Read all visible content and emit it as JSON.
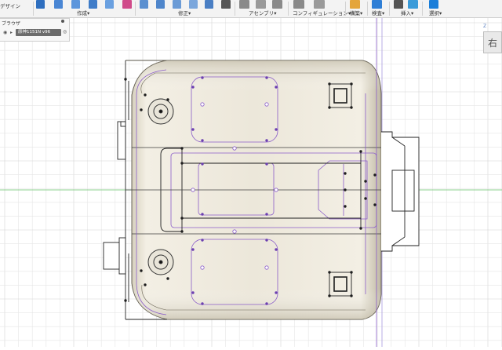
{
  "toolbar": {
    "sections": [
      {
        "label": "作成",
        "color": "#3a78c9"
      },
      {
        "label": "修正",
        "color": "#5a8fd0"
      },
      {
        "label": "アセンブリ",
        "color": "#7b7b7b"
      },
      {
        "label": "コンフィギュレーション",
        "color": "#7b7b7b"
      },
      {
        "label": "構築",
        "color": "#e4a53b"
      },
      {
        "label": "検査",
        "color": "#2f7fd6"
      },
      {
        "label": "挿入",
        "color": "#3a9bd9"
      },
      {
        "label": "選択",
        "color": "#1a7ed9"
      }
    ],
    "dropdown_glyph": "▾",
    "left_cut_label": "デザイン"
  },
  "browser": {
    "title": "ブラウザ",
    "document_label": "原神1151N v96"
  },
  "viewcube": {
    "face_label": "右",
    "axis_label": "Z"
  },
  "colors": {
    "grid_minor": "#e6e6e6",
    "grid_major": "#d2d2d2",
    "body_fill": "#d8d2c2",
    "body_light": "#f2eee4",
    "sketch_purple": "#8a5cc9",
    "sketch_black": "#1e1e1e",
    "axis_green": "#69c36a",
    "axis_red": "#d46a6a"
  }
}
